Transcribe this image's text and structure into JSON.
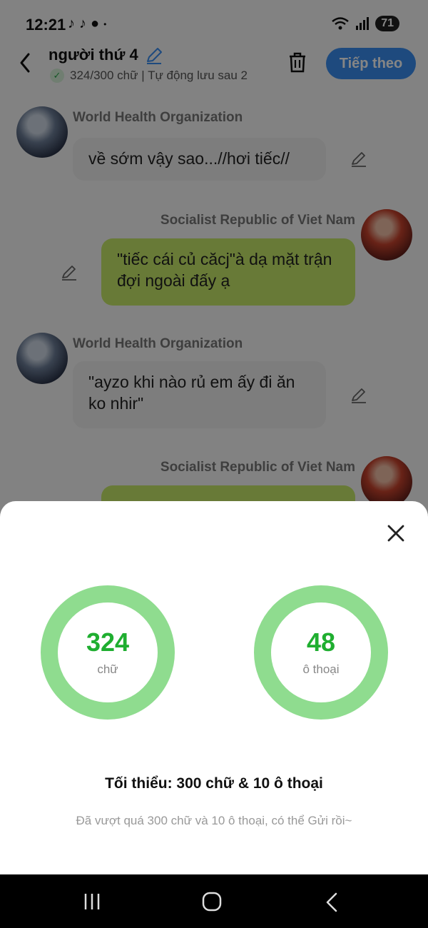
{
  "status_bar": {
    "time": "12:21",
    "battery": "71",
    "left_icons": [
      "tiktok-icon",
      "tiktok-icon",
      "account-icon",
      "dot-icon"
    ],
    "right_icons": [
      "wifi-icon",
      "signal-icon",
      "battery-icon"
    ]
  },
  "header": {
    "title": "người thứ 4",
    "subtitle": "324/300 chữ | Tự động lưu sau 2",
    "next_label": "Tiếp theo"
  },
  "messages": [
    {
      "side": "left",
      "sender": "World Health Organization",
      "text": "về sớm vậy sao...//hơi tiếc//"
    },
    {
      "side": "right",
      "sender": "Socialist Republic of Viet Nam",
      "text": "\"tiếc cái củ căcj\"à dạ mặt trận đợi ngoài đấy ạ"
    },
    {
      "side": "left",
      "sender": "World Health Organization",
      "text": "\"ayzo khi nào rủ em ấy đi ăn ko nhir\""
    },
    {
      "side": "right",
      "sender": "Socialist Republic of Viet Nam",
      "text": ""
    }
  ],
  "sheet": {
    "words_value": "324",
    "words_unit": "chữ",
    "dialogs_value": "48",
    "dialogs_unit": "ô thoại",
    "minimum": "Tối thiểu: 300 chữ & 10 ô thoại",
    "note": "Đã vượt quá 300 chữ và 10 ô thoại, có thể Gửi rồi~"
  },
  "colors": {
    "accent_blue": "#3b8ff2",
    "ring_green": "#8fdc8f",
    "value_green": "#1fae30",
    "bubble_right": "#c7ea6a",
    "bubble_left": "#f0f0f0"
  }
}
